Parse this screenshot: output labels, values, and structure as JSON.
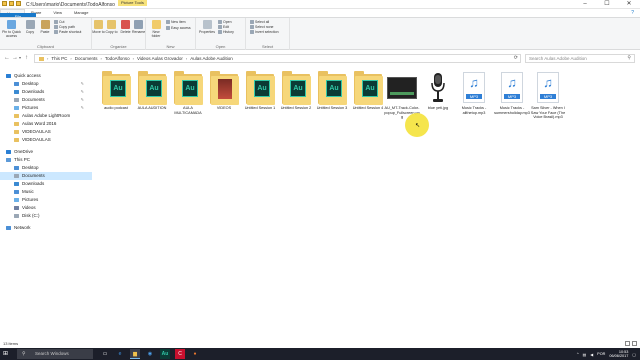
{
  "window": {
    "path_title": "C:\\Users\\mario\\Documents\\TodoAlfonso",
    "context_tab": "Picture Tools"
  },
  "tabs": [
    {
      "label": "File"
    },
    {
      "label": "Home"
    },
    {
      "label": "Share"
    },
    {
      "label": "View"
    },
    {
      "label": "Manage"
    }
  ],
  "ribbon": {
    "clipboard": {
      "name": "Clipboard",
      "pin": "Pin to Quick access",
      "copy": "Copy",
      "paste": "Paste",
      "cut": "Cut",
      "copy_path": "Copy path",
      "paste_shortcut": "Paste shortcut"
    },
    "organize": {
      "name": "Organize",
      "move_to": "Move to",
      "copy_to": "Copy to",
      "delete": "Delete",
      "rename": "Rename"
    },
    "new": {
      "name": "New",
      "new_folder": "New folder",
      "new_item": "New item",
      "easy_access": "Easy access"
    },
    "open": {
      "name": "Open",
      "properties": "Properties",
      "open": "Open",
      "edit": "Edit",
      "history": "History"
    },
    "select": {
      "name": "Select",
      "select_all": "Select all",
      "select_none": "Select none",
      "invert": "Invert selection"
    }
  },
  "breadcrumb": [
    "This PC",
    "Documents",
    "TodoAlfonso",
    "Videos Aulas Grovador",
    "Aulas Adobe Audition"
  ],
  "search": {
    "placeholder": "Search Aulas Adobe Audition"
  },
  "nav": {
    "items": [
      {
        "label": "Quick access",
        "icon": "star-icon",
        "level": 0
      },
      {
        "label": "Desktop",
        "icon": "desktop-icon",
        "level": 1,
        "pinned": true
      },
      {
        "label": "Downloads",
        "icon": "download-icon",
        "level": 1,
        "pinned": true
      },
      {
        "label": "Documents",
        "icon": "documents-icon",
        "level": 1,
        "pinned": true
      },
      {
        "label": "Pictures",
        "icon": "pictures-icon",
        "level": 1,
        "pinned": true
      },
      {
        "label": "Aulas Adobe LightRoom",
        "icon": "folder-icon",
        "level": 1
      },
      {
        "label": "Aulas Word 2016",
        "icon": "folder-icon",
        "level": 1
      },
      {
        "label": "VIDEOAULAS",
        "icon": "folder-icon",
        "level": 1
      },
      {
        "label": "VIDEOAULAS",
        "icon": "folder-icon",
        "level": 1
      },
      {
        "label": "OneDrive",
        "icon": "cloud-icon",
        "level": 0
      },
      {
        "label": "This PC",
        "icon": "computer-icon",
        "level": 0
      },
      {
        "label": "Desktop",
        "icon": "desktop-icon",
        "level": 1
      },
      {
        "label": "Documents",
        "icon": "documents-icon",
        "level": 1,
        "selected": true
      },
      {
        "label": "Downloads",
        "icon": "download-icon",
        "level": 1
      },
      {
        "label": "Music",
        "icon": "music-icon",
        "level": 1
      },
      {
        "label": "Pictures",
        "icon": "pictures-icon",
        "level": 1
      },
      {
        "label": "Videos",
        "icon": "videos-icon",
        "level": 1
      },
      {
        "label": "Disk (C:)",
        "icon": "drive-icon",
        "level": 1
      },
      {
        "label": "Network",
        "icon": "network-icon",
        "level": 0
      }
    ]
  },
  "files": [
    {
      "name": "audio podcast",
      "type": "folder-au"
    },
    {
      "name": "AULA AUDITION",
      "type": "folder-au"
    },
    {
      "name": "AULA MULTICAMADA",
      "type": "folder-au"
    },
    {
      "name": "VIDEOS",
      "type": "folder-photo"
    },
    {
      "name": "Untitled Session 1",
      "type": "folder-au"
    },
    {
      "name": "Untitled Session 2",
      "type": "folder-au"
    },
    {
      "name": "Untitled Session 3",
      "type": "folder-au"
    },
    {
      "name": "Untitled Session 4",
      "type": "folder-au"
    },
    {
      "name": "AU_MT-Track-Color-popup_Fullscreen.png",
      "type": "image-screen"
    },
    {
      "name": "blue yeti.jpg",
      "type": "image-mic"
    },
    {
      "name": "Music Tracks - allthetop.mp3",
      "type": "mp3"
    },
    {
      "name": "Music Tracks - summersholiday.mp3",
      "type": "mp3"
    },
    {
      "name": "Sam Silver - When I Saw Your Face (The Voice Brasil).mp3",
      "type": "mp3"
    }
  ],
  "mp3_label": "MP3",
  "status": {
    "count": "13 items"
  },
  "taskbar": {
    "search_placeholder": "Search Windows",
    "time": "10:53",
    "date": "06/06/2017",
    "lang": "POR"
  }
}
